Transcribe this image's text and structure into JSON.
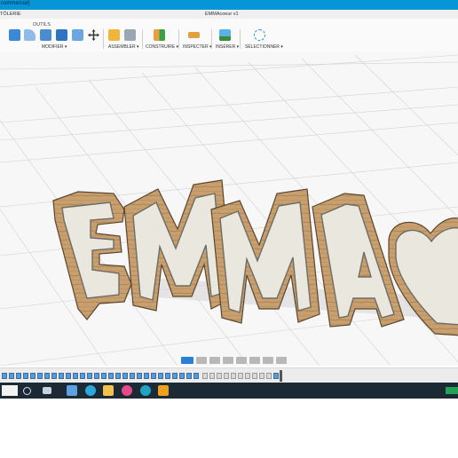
{
  "titlebar": {
    "title": "commercial)",
    "accent": "#0696d7"
  },
  "tabstrip": {
    "left_label": "TÔLERIE",
    "document_title": "EMMAcoeur v1"
  },
  "toolbar": {
    "outils_tab": "OUTILS",
    "groups": [
      {
        "label": "MODIFIER ▾"
      },
      {
        "label": "ASSEMBLER ▾"
      },
      {
        "label": "CONSTRUIRE ▾"
      },
      {
        "label": "INSPECTER ▾"
      },
      {
        "label": "INSÉRER ▾"
      },
      {
        "label": "SÉLECTIONNER ▾"
      }
    ]
  },
  "model": {
    "text": "EMMA",
    "shape_after_text": "heart",
    "wood_color": "#c8a070",
    "face_color": "#e9e7de"
  },
  "colors": {
    "taskbar": "#1c2a36",
    "timeline_feature": "#5b9bd5",
    "nav_active": "#2a7fd6"
  }
}
